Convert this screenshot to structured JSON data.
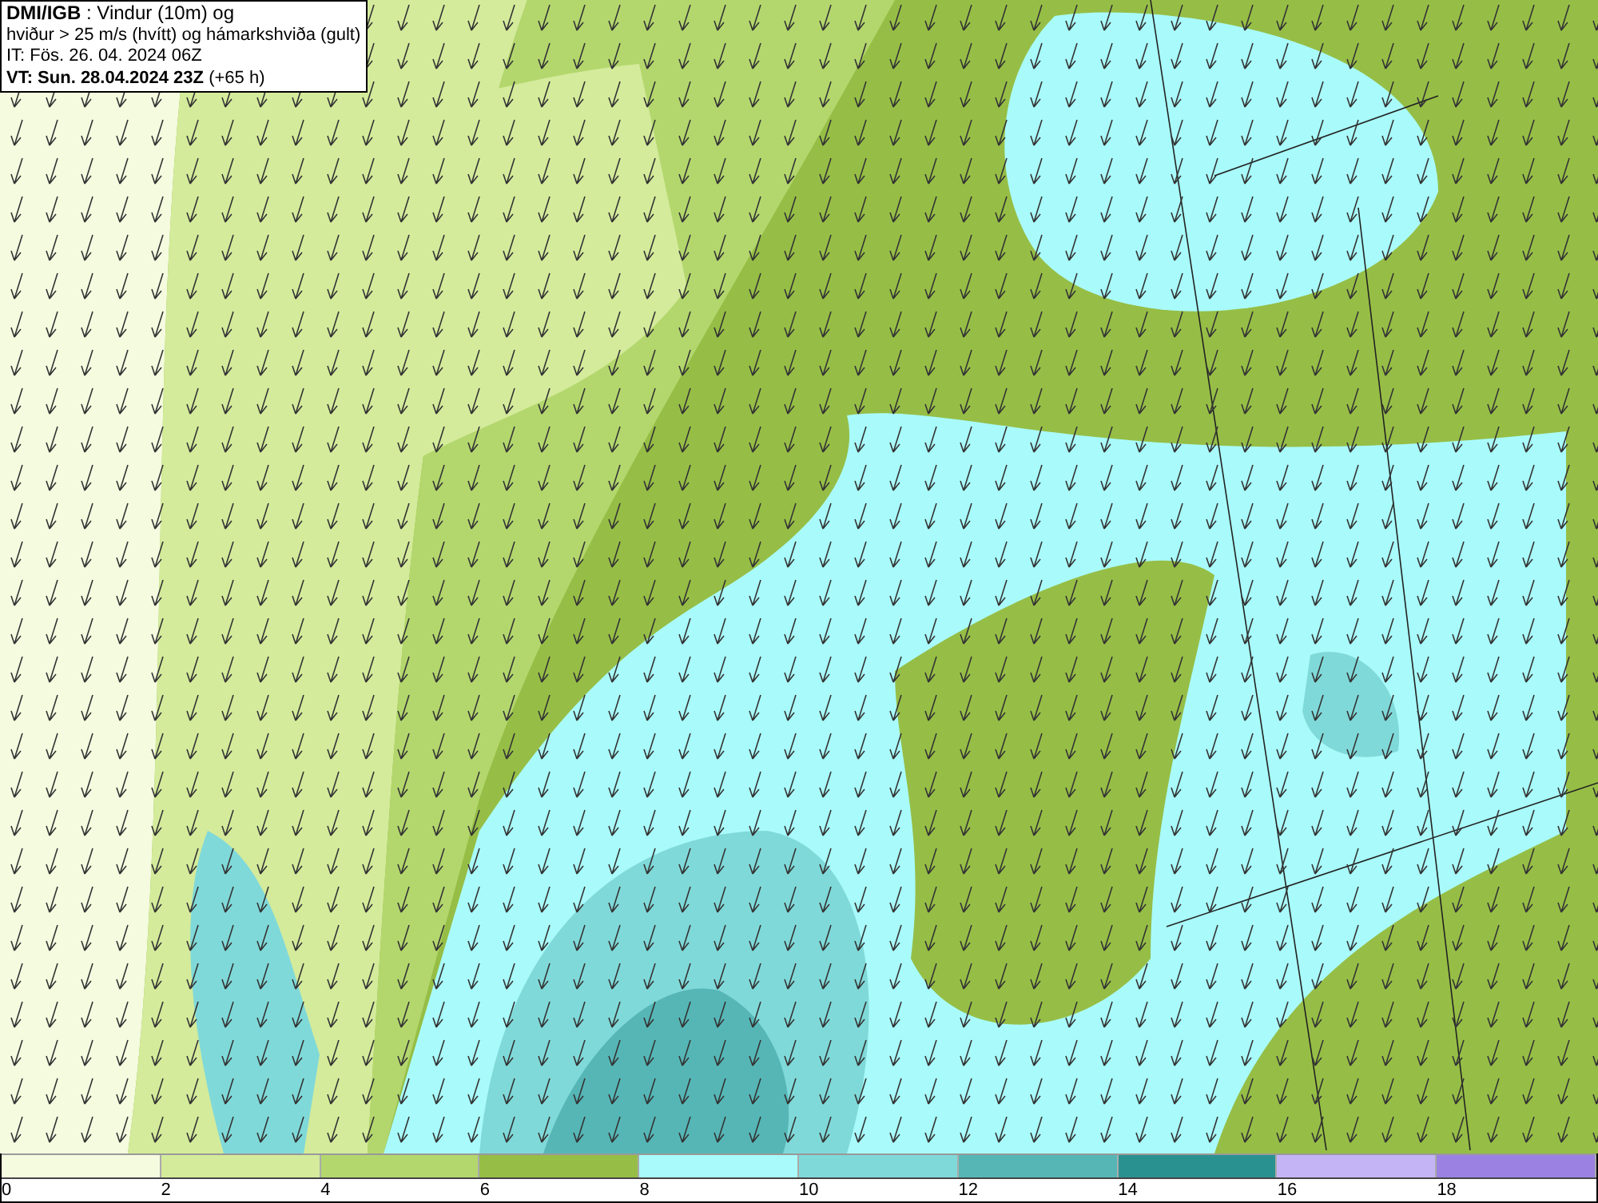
{
  "header": {
    "lines": [
      "**DMI/IGB** : Vindur (10m) og",
      "hviður > 25 m/s (hvítt) og hámarkshviða (gult)",
      "IT: Fös. 26. 04. 2024 06Z",
      "**VT: Sun. 28.04.2024 23Z** (+65 h)"
    ]
  },
  "legend": [
    {
      "label": "0",
      "color": "#f4fbdf"
    },
    {
      "label": "2",
      "color": "#d4eb9b"
    },
    {
      "label": "4",
      "color": "#b3d76d"
    },
    {
      "label": "6",
      "color": "#96be46"
    },
    {
      "label": "8",
      "color": "#a9fafa"
    },
    {
      "label": "10",
      "color": "#80d9d9"
    },
    {
      "label": "12",
      "color": "#56b6b6"
    },
    {
      "label": "14",
      "color": "#2a9191"
    },
    {
      "label": "16",
      "color": "#c4b4f6"
    },
    {
      "label": "18",
      "color": "#9b81e1"
    }
  ]
}
